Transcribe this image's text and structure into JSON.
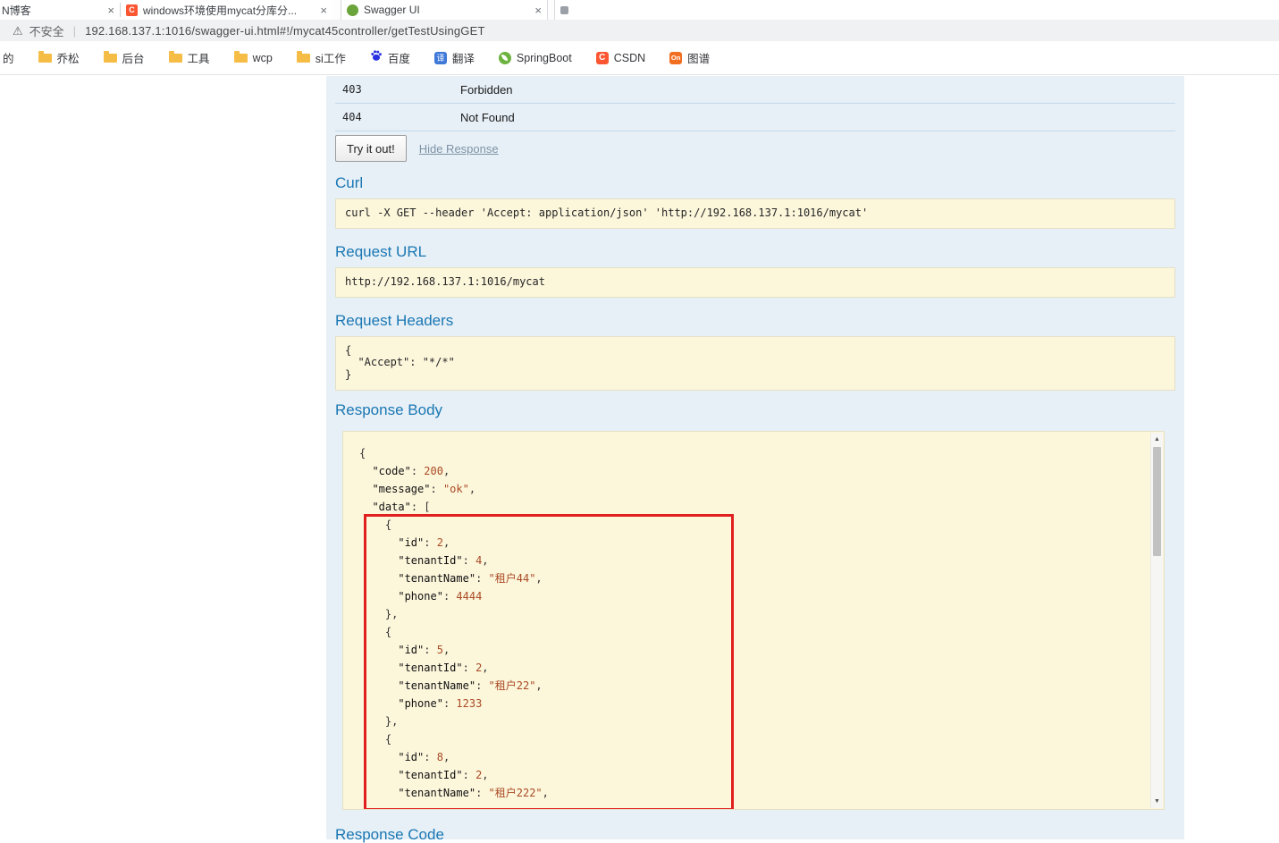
{
  "colors": {
    "swagger_heading_blue": "#1a77b3",
    "operation_background_blue": "#e7f0f7",
    "row_border_blue": "#c3d9ec",
    "code_box_yellow": "#fcf6db",
    "code_box_border": "#e5e0c6",
    "json_value_brown": "#aa4a24",
    "annotation_red": "#e01f1f",
    "csdn_red": "#fc5531",
    "spring_green": "#6db33f",
    "baidu_blue": "#2932e1",
    "folder_yellow": "#f6bd46"
  },
  "browser": {
    "tabs": [
      {
        "title": "N博客",
        "close": "×"
      },
      {
        "title": "windows环境使用mycat分库分...",
        "close": "×"
      },
      {
        "title": "Swagger UI",
        "close": "×"
      },
      {
        "title": "",
        "close": ""
      }
    ],
    "address": {
      "warning_label": "不安全",
      "separator": "|",
      "url": "192.168.137.1:1016/swagger-ui.html#!/mycat45controller/getTestUsingGET"
    },
    "bookmarks": [
      {
        "label": "的"
      },
      {
        "label": "乔松"
      },
      {
        "label": "后台"
      },
      {
        "label": "工具"
      },
      {
        "label": "wcp"
      },
      {
        "label": "si工作"
      },
      {
        "label": "百度"
      },
      {
        "label": "翻译"
      },
      {
        "label": "SpringBoot"
      },
      {
        "label": "CSDN"
      },
      {
        "label": "图谱"
      }
    ],
    "bookmark_icon_glyphs": {
      "translate": "译",
      "csdn": "C",
      "on": "On"
    }
  },
  "swagger": {
    "response_messages": [
      {
        "code": "403",
        "reason": "Forbidden"
      },
      {
        "code": "404",
        "reason": "Not Found"
      }
    ],
    "try_it_out_label": "Try it out!",
    "hide_response_label": "Hide Response",
    "curl": {
      "title": "Curl",
      "command": "curl -X GET --header 'Accept: application/json' 'http://192.168.137.1:1016/mycat'"
    },
    "request_url": {
      "title": "Request URL",
      "value": "http://192.168.137.1:1016/mycat"
    },
    "request_headers": {
      "title": "Request Headers",
      "value": "{\n  \"Accept\": \"*/*\"\n}"
    },
    "response_body": {
      "title": "Response Body",
      "value": "{\n  \"code\": 200,\n  \"message\": \"ok\",\n  \"data\": [\n    {\n      \"id\": 2,\n      \"tenantId\": 4,\n      \"tenantName\": \"租户44\",\n      \"phone\": 4444\n    },\n    {\n      \"id\": 5,\n      \"tenantId\": 2,\n      \"tenantName\": \"租户22\",\n      \"phone\": 1233\n    },\n    {\n      \"id\": 8,\n      \"tenantId\": 2,\n      \"tenantName\": \"租户222\","
    },
    "response_code": {
      "title": "Response Code"
    }
  }
}
